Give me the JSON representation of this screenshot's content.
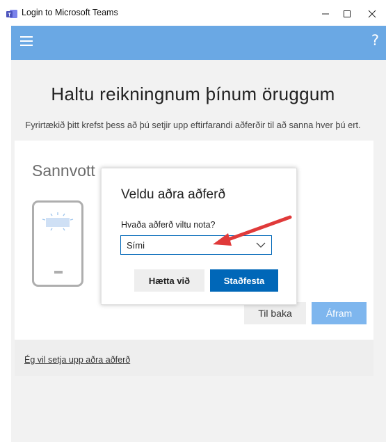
{
  "window": {
    "title": "Login to Microsoft Teams",
    "app_icon": "teams-icon",
    "controls": [
      "minimize-icon",
      "maximize-icon",
      "close-icon"
    ]
  },
  "header": {
    "menu_icon": "hamburger-icon",
    "help_label": "?",
    "color": "#6aa8e4"
  },
  "page": {
    "title": "Haltu reikningnum þínum öruggum",
    "subtitle": "Fyrirtækið þitt krefst þess að þú setjir upp eftirfarandi aðferðir til að sanna hver þú ert."
  },
  "card": {
    "heading": "Sannvott",
    "illustration": "phone-icon",
    "back_label": "Til baka",
    "next_label": "Áfram",
    "alt_method_link": "Ég vil setja upp aðra aðferð"
  },
  "dialog": {
    "title": "Veldu aðra aðferð",
    "question": "Hvaða aðferð viltu nota?",
    "selected_option": "Sími",
    "cancel_label": "Hætta við",
    "confirm_label": "Staðfesta",
    "accent_color": "#0067b8"
  },
  "annotation": {
    "arrow_color": "#e03a3a"
  }
}
